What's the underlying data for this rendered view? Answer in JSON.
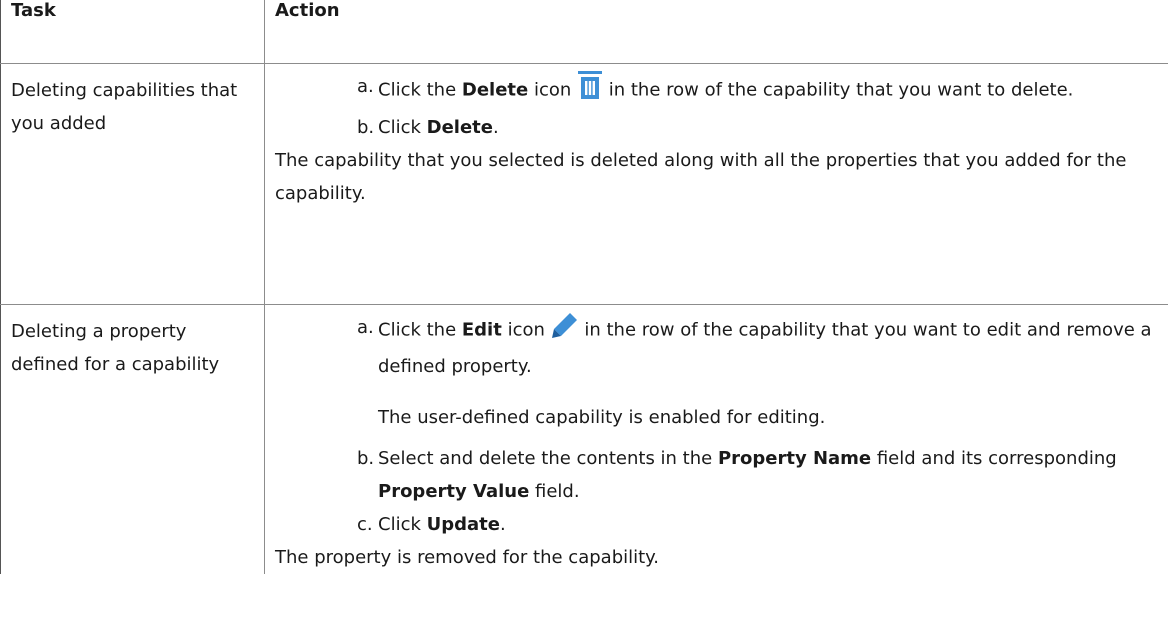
{
  "header": {
    "task": "Task",
    "action": "Action"
  },
  "rows": [
    {
      "task": "Deleting capabilities that you added",
      "steps": [
        {
          "letter": "a.",
          "pre": "Click the ",
          "bold": "Delete",
          "mid": " icon",
          "icon": "trash-icon",
          "post": " in the row of the capability that you want to delete."
        },
        {
          "letter": "b.",
          "pre": "Click ",
          "bold": "Delete",
          "post": "."
        }
      ],
      "result": "The capability that you selected is deleted along with all the properties that you added for the capability."
    },
    {
      "task": "Deleting a property defined for a capability",
      "steps": [
        {
          "letter": "a.",
          "pre": "Click the ",
          "bold": "Edit",
          "mid": " icon",
          "icon": "pencil-icon",
          "post": " in the row of the capability that you want to edit and remove a defined property.",
          "note": "The user-defined capability is enabled for editing."
        },
        {
          "letter": "b.",
          "pre": "Select and delete the contents in the ",
          "bold": "Property Name",
          "mid": " field and its corresponding ",
          "bold2": "Property Value",
          "post": " field."
        },
        {
          "letter": "c.",
          "pre": "Click ",
          "bold": "Update",
          "post": "."
        }
      ],
      "result": "The property is removed for the capability."
    }
  ],
  "colors": {
    "icon_blue": "#3d8fd6",
    "border": "#8c8c8c"
  }
}
